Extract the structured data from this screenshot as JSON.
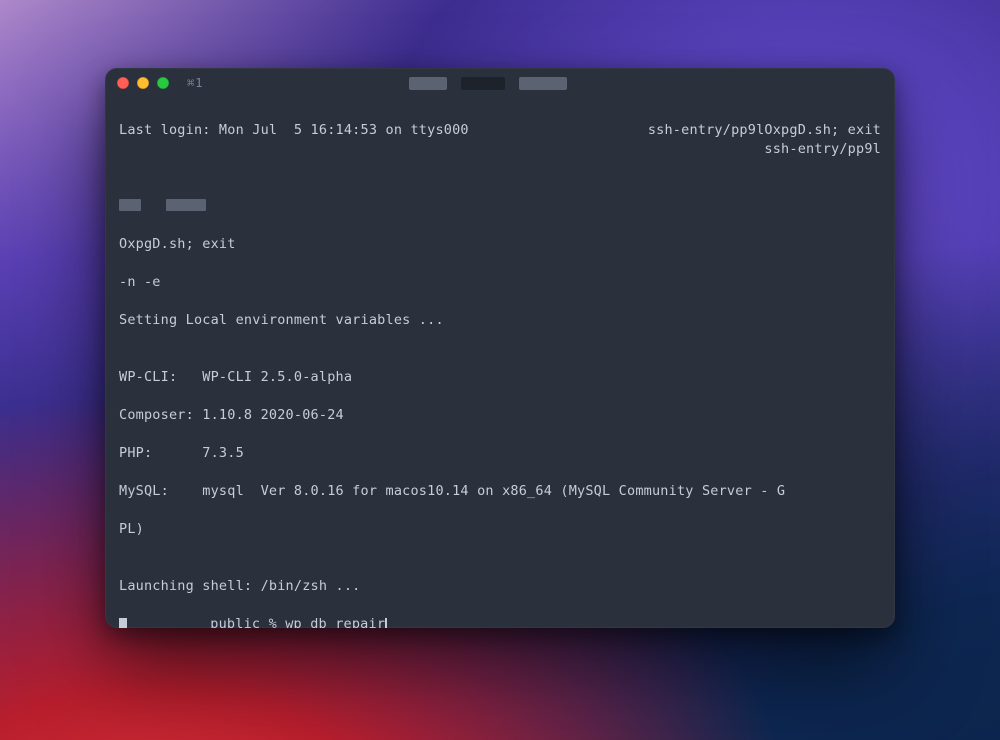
{
  "titlebar": {
    "tab_indicator": "⌘1"
  },
  "lines": {
    "last_login": "Last login: Mon Jul  5 16:14:53 on ttys000",
    "ssh_entry_right1": "ssh-entry/pp9lOxpgD.sh; exit",
    "ssh_entry_right2": "ssh-entry/pp9l",
    "oxpgd": "OxpgD.sh; exit",
    "n_e": "-n -e",
    "setting_env": "Setting Local environment variables ...",
    "wpcli": "WP-CLI:   WP-CLI 2.5.0-alpha",
    "composer": "Composer: 1.10.8 2020-06-24",
    "php": "PHP:      7.3.5",
    "mysql1": "MySQL:    mysql  Ver 8.0.16 for macos10.14 on x86_64 (MySQL Community Server - G",
    "mysql2": "PL)",
    "launching": "Launching shell: /bin/zsh ...",
    "prompt_dir": "public",
    "prompt_sym": "%",
    "command": "wp db repair"
  }
}
